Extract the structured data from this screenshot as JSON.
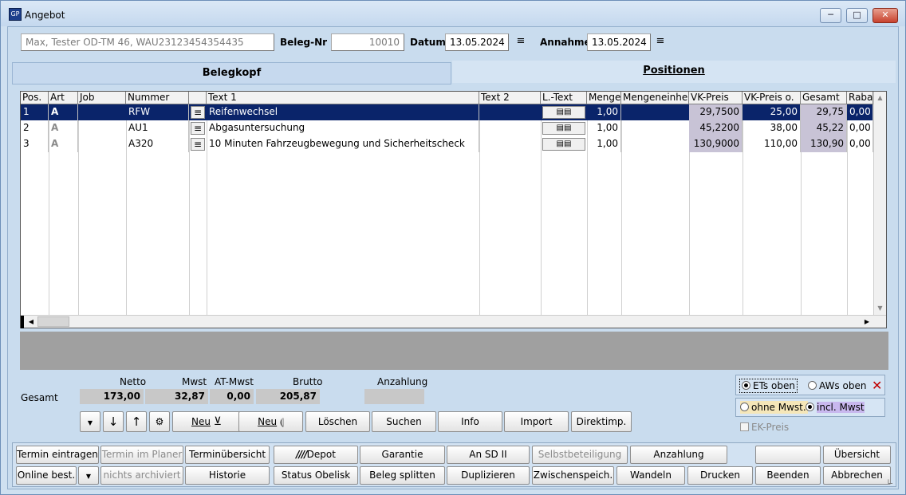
{
  "window": {
    "title": "Angebot",
    "icon_text": "GP"
  },
  "header": {
    "customer": "Max, Tester OD-TM 46, WAU23123454354435",
    "beleg_label": "Beleg-Nr",
    "beleg_value": "10010",
    "datum_label": "Datum",
    "datum_value": "13.05.2024",
    "annahme_label": "Annahme",
    "annahme_value": "13.05.2024"
  },
  "tabs": [
    {
      "label": "Belegkopf"
    },
    {
      "label": "Positionen"
    }
  ],
  "grid": {
    "columns": [
      "Pos.",
      "Art",
      "Job",
      "Nummer",
      "",
      "Text 1",
      "Text 2",
      "L.-Text",
      "Menge",
      "Mengeneinheit",
      "VK-Preis",
      "VK-Preis o.",
      "Gesamt",
      "Rabatt"
    ],
    "rows": [
      {
        "pos": "1",
        "art": "A",
        "job": "",
        "nummer": "RFW",
        "text1": "Reifenwechsel",
        "text2": "",
        "menge": "1,00",
        "einheit": "",
        "vk": "29,7500",
        "vko": "25,00",
        "gesamt": "29,75",
        "rabatt": "0,00"
      },
      {
        "pos": "2",
        "art": "A",
        "job": "",
        "nummer": "AU1",
        "text1": "Abgasuntersuchung",
        "text2": "",
        "menge": "1,00",
        "einheit": "",
        "vk": "45,2200",
        "vko": "38,00",
        "gesamt": "45,22",
        "rabatt": "0,00"
      },
      {
        "pos": "3",
        "art": "A",
        "job": "",
        "nummer": "A320",
        "text1": "10 Minuten Fahrzeugbewegung und Sicherheitscheck",
        "text2": "",
        "menge": "1,00",
        "einheit": "",
        "vk": "130,9000",
        "vko": "110,00",
        "gesamt": "130,90",
        "rabatt": "0,00"
      }
    ]
  },
  "totals": {
    "label": "Gesamt",
    "netto_label": "Netto",
    "netto": "173,00",
    "mwst_label": "Mwst",
    "mwst": "32,87",
    "atmwst_label": "AT-Mwst",
    "atmwst": "0,00",
    "brutto_label": "Brutto",
    "brutto": "205,87",
    "anzahlung_label": "Anzahlung",
    "anzahlung": ""
  },
  "actions": {
    "neu1": "Neu",
    "neu2": "Neu",
    "loeschen": "Löschen",
    "suchen": "Suchen",
    "info": "Info",
    "import": "Import",
    "direktimp": "Direktimp."
  },
  "options": {
    "ets_oben": "ETs oben",
    "aws_oben": "AWs oben",
    "ohne_mwst": "ohne Mwst.",
    "incl_mwst": "incl. Mwst",
    "ek_preis": "EK-Preis"
  },
  "bottom_row1": [
    "Termin eintragen",
    "Termin im Planer",
    "Terminübersicht",
    "Depot",
    "Garantie",
    "An SD II",
    "Selbstbeteiligung",
    "Anzahlung",
    "",
    "Übersicht"
  ],
  "bottom_row2": [
    "Online best.",
    "nichts archiviert",
    "Historie",
    "Status Obelisk",
    "Beleg splitten",
    "Duplizieren",
    "Zwischenspeich.",
    "Wandeln",
    "Drucken",
    "Beenden",
    "Abbrechen"
  ],
  "colors": {
    "selected_row": "#0a246a",
    "accent": "#c6d9ee",
    "close": "#c7412d"
  }
}
